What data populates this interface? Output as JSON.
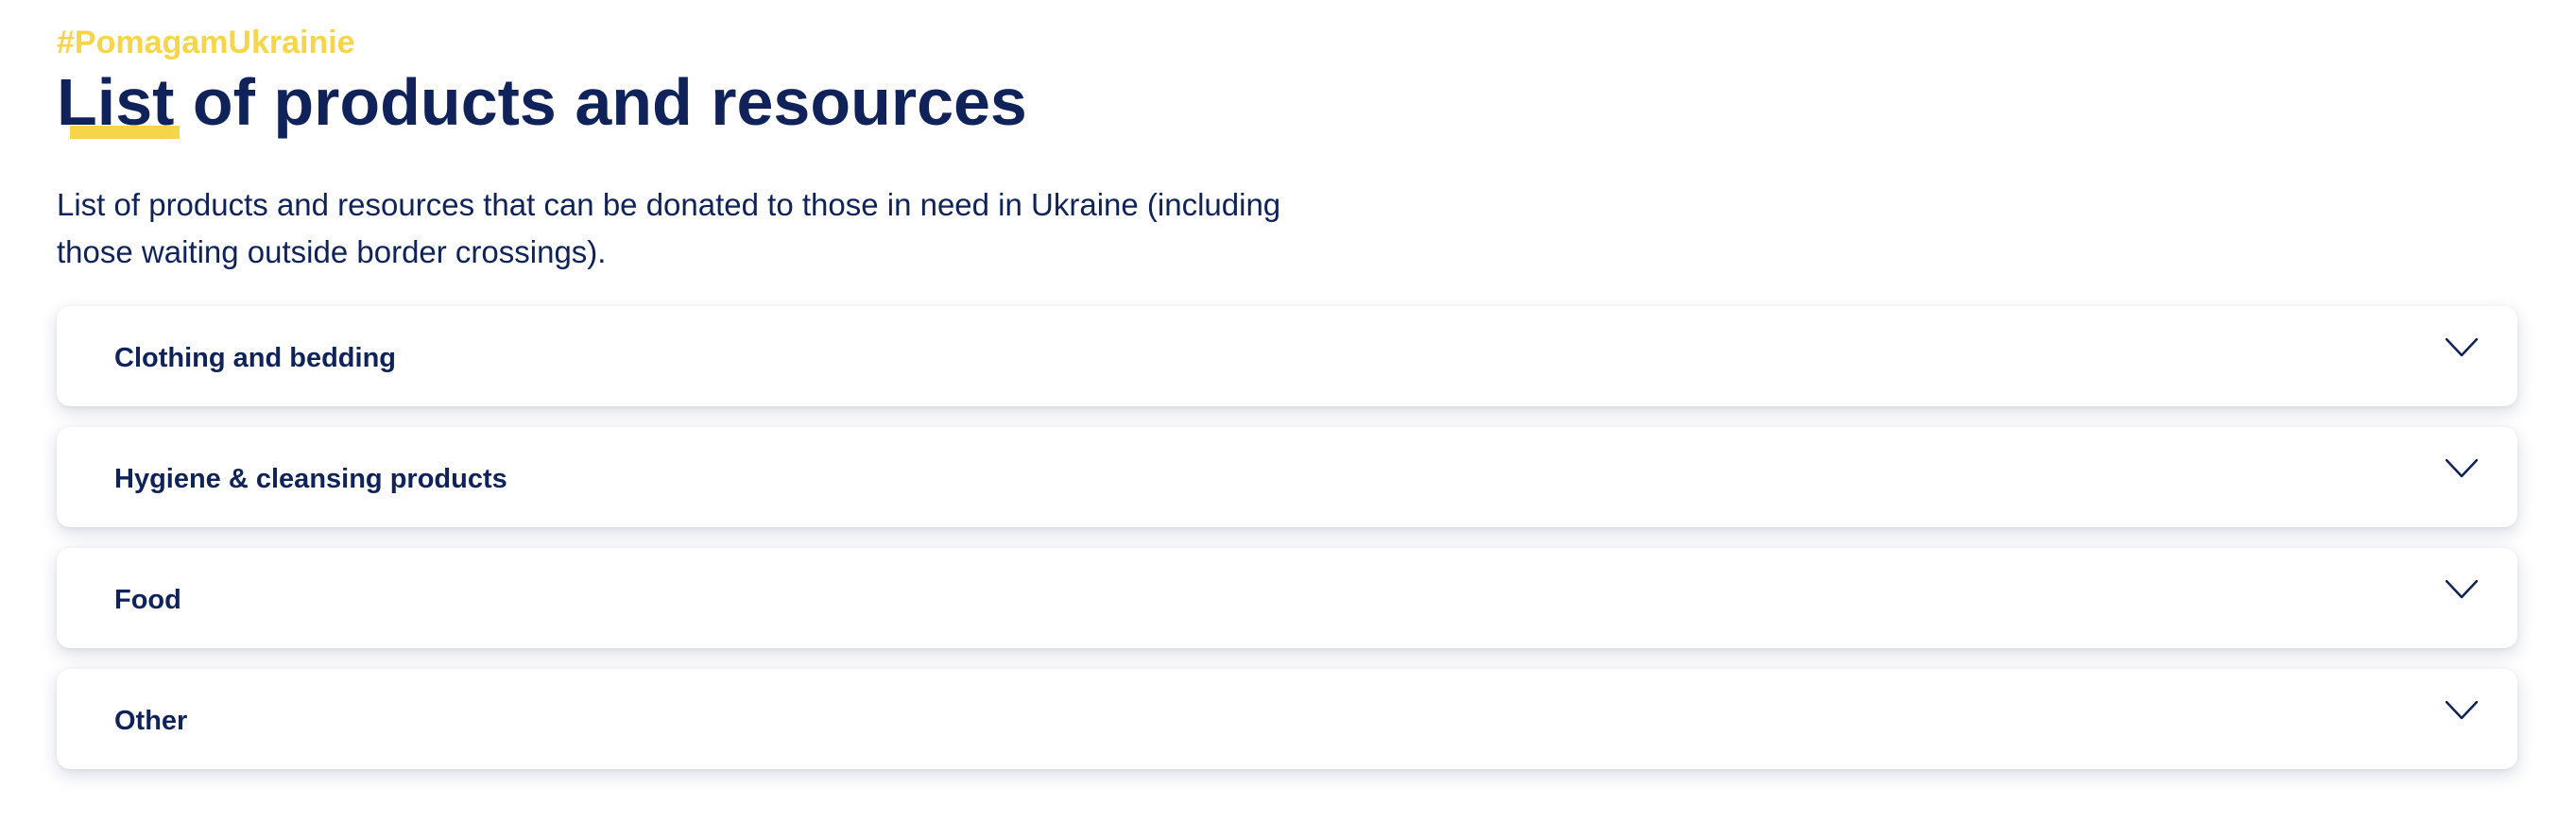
{
  "header": {
    "hashtag": "#PomagamUkrainie",
    "title_first_word": "List",
    "title_rest": " of products and resources"
  },
  "description": "List of products and resources that can be donated to those in need in Ukraine (including those waiting outside border crossings).",
  "accordion": {
    "items": [
      {
        "label": "Clothing and bedding",
        "icon": "chevron-down-icon"
      },
      {
        "label": "Hygiene & cleansing products",
        "icon": "chevron-down-icon"
      },
      {
        "label": "Food",
        "icon": "chevron-down-icon"
      },
      {
        "label": "Other",
        "icon": "chevron-down-icon"
      }
    ]
  },
  "colors": {
    "accent_yellow": "#f7d54a",
    "text_navy": "#10225a"
  }
}
